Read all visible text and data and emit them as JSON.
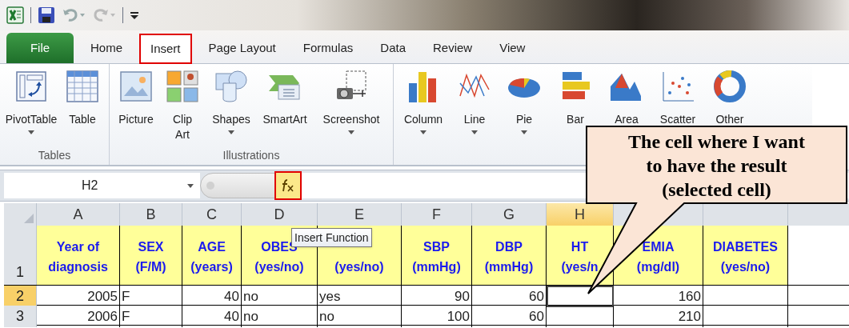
{
  "tabs": [
    {
      "label": "File",
      "kind": "file",
      "selected": false,
      "highlighted": false
    },
    {
      "label": "Home",
      "kind": "tab",
      "selected": false,
      "highlighted": false
    },
    {
      "label": "Insert",
      "kind": "tab",
      "selected": true,
      "highlighted": true
    },
    {
      "label": "Page Layout",
      "kind": "tab",
      "selected": false,
      "highlighted": false
    },
    {
      "label": "Formulas",
      "kind": "tab",
      "selected": false,
      "highlighted": false
    },
    {
      "label": "Data",
      "kind": "tab",
      "selected": false,
      "highlighted": false
    },
    {
      "label": "Review",
      "kind": "tab",
      "selected": false,
      "highlighted": false
    },
    {
      "label": "View",
      "kind": "tab",
      "selected": false,
      "highlighted": false
    }
  ],
  "ribbon": {
    "groups": [
      {
        "label": "Tables",
        "buttons": [
          {
            "label": "PivotTable",
            "dropdown": true
          },
          {
            "label": "Table",
            "dropdown": false
          }
        ]
      },
      {
        "label": "Illustrations",
        "buttons": [
          {
            "label": "Picture",
            "dropdown": false
          },
          {
            "label": "Clip Art",
            "dropdown": false
          },
          {
            "label": "Shapes",
            "dropdown": true
          },
          {
            "label": "SmartArt",
            "dropdown": false
          },
          {
            "label": "Screenshot",
            "dropdown": true
          }
        ]
      },
      {
        "buttons": [
          {
            "label": "Column",
            "dropdown": true
          },
          {
            "label": "Line",
            "dropdown": true
          },
          {
            "label": "Pie",
            "dropdown": true
          },
          {
            "label": "Bar"
          },
          {
            "label": "Area"
          },
          {
            "label": "Scatter"
          },
          {
            "label": "Other"
          }
        ]
      }
    ]
  },
  "formula_bar": {
    "name_box": "H2",
    "insert_function": {
      "highlighted": true
    },
    "tooltip": "Insert Function"
  },
  "sheet": {
    "columns": [
      {
        "letter": "A",
        "selected": false
      },
      {
        "letter": "B",
        "selected": false
      },
      {
        "letter": "C",
        "selected": false
      },
      {
        "letter": "D",
        "selected": false
      },
      {
        "letter": "E",
        "selected": false
      },
      {
        "letter": "F",
        "selected": false
      },
      {
        "letter": "G",
        "selected": false
      },
      {
        "letter": "H",
        "selected": true
      },
      {},
      {}
    ],
    "rows": [
      {
        "number": "1",
        "kind": "header",
        "selected": false,
        "cells": [
          [
            "Year of",
            "diagnosis"
          ],
          [
            "SEX",
            "(F/M)"
          ],
          [
            "AGE",
            "(years)"
          ],
          [
            "OBES",
            "(yes/no)"
          ],
          [
            "(yes/no)"
          ],
          [
            "SBP",
            "(mmHg)"
          ],
          [
            "DBP",
            "(mmHg)"
          ],
          [
            "HT",
            "(yes/n"
          ],
          [
            "EMIA",
            "(mg/dl)"
          ],
          [
            "DIABETES",
            "(yes/no)"
          ]
        ]
      },
      {
        "number": "2",
        "kind": "data",
        "selected": true,
        "cells": [
          {
            "text": "2005",
            "kind": "number"
          },
          {
            "text": "F",
            "kind": "text"
          },
          {
            "text": "40",
            "kind": "number"
          },
          {
            "text": "no",
            "kind": "text"
          },
          {
            "text": "yes",
            "kind": "text"
          },
          {
            "text": "90",
            "kind": "number"
          },
          {
            "text": "60",
            "kind": "number"
          },
          null,
          {
            "text": "160",
            "kind": "number"
          },
          null
        ]
      },
      {
        "number": "3",
        "kind": "data",
        "selected": false,
        "cells": [
          {
            "text": "2006",
            "kind": "number"
          },
          {
            "text": "F",
            "kind": "text"
          },
          {
            "text": "40",
            "kind": "number"
          },
          {
            "text": "no",
            "kind": "text"
          },
          {
            "text": "no",
            "kind": "text"
          },
          {
            "text": "100",
            "kind": "number"
          },
          {
            "text": "60",
            "kind": "number"
          },
          null,
          {
            "text": "210",
            "kind": "number"
          },
          null
        ]
      }
    ]
  },
  "callout": {
    "lines": [
      "The cell where I want",
      "to have the result",
      "(selected cell)"
    ]
  }
}
